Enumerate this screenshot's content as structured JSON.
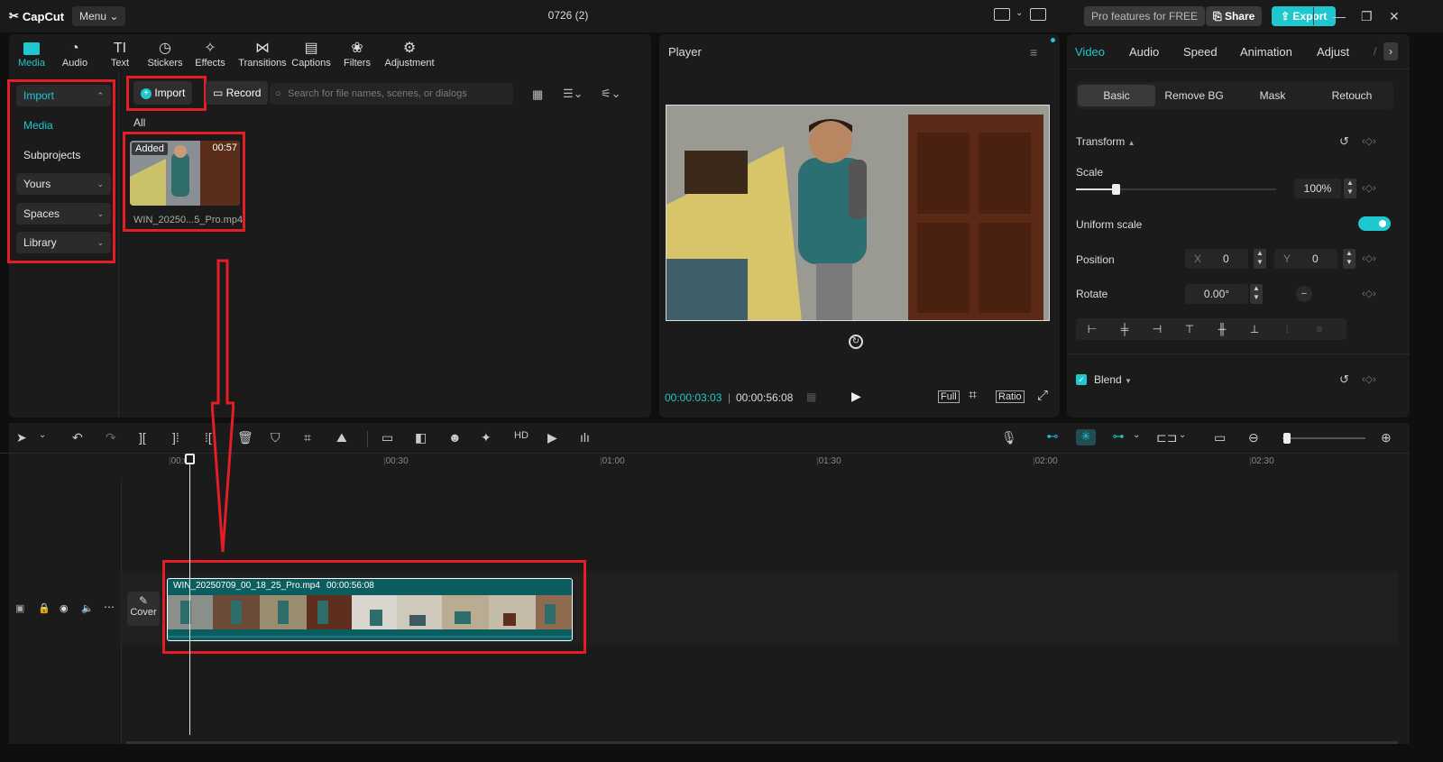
{
  "titlebar": {
    "logo": "CapCut",
    "menu": "Menu",
    "project_title": "0726 (2)",
    "pro_features": "Pro features for FREE",
    "share": "Share",
    "export": "Export"
  },
  "toolbar": {
    "tools": [
      {
        "label": "Media",
        "icon": "media-icon"
      },
      {
        "label": "Audio",
        "icon": "audio-icon"
      },
      {
        "label": "Text",
        "icon": "text-icon"
      },
      {
        "label": "Stickers",
        "icon": "stickers-icon"
      },
      {
        "label": "Effects",
        "icon": "effects-icon"
      },
      {
        "label": "Transitions",
        "icon": "transitions-icon"
      },
      {
        "label": "Captions",
        "icon": "captions-icon"
      },
      {
        "label": "Filters",
        "icon": "filters-icon"
      },
      {
        "label": "Adjustment",
        "icon": "adjustment-icon"
      }
    ]
  },
  "sidebar": {
    "items": [
      {
        "label": "Import"
      },
      {
        "label": "Media"
      },
      {
        "label": "Subprojects"
      },
      {
        "label": "Yours"
      },
      {
        "label": "Spaces"
      },
      {
        "label": "Library"
      }
    ]
  },
  "media": {
    "import_button": "Import",
    "record_button": "Record",
    "search_placeholder": "Search for file names, scenes, or dialogs",
    "filter_all": "All",
    "item": {
      "badge": "Added",
      "duration": "00:57",
      "filename": "WIN_20250...5_Pro.mp4"
    }
  },
  "player": {
    "title": "Player",
    "current_time": "00:00:03:03",
    "total_time": "00:00:56:08",
    "full_label": "Full",
    "ratio_label": "Ratio"
  },
  "properties": {
    "tabs": [
      "Video",
      "Audio",
      "Speed",
      "Animation",
      "Adjust"
    ],
    "subtabs": [
      "Basic",
      "Remove BG",
      "Mask",
      "Retouch"
    ],
    "transform_label": "Transform",
    "scale_label": "Scale",
    "scale_value": "100%",
    "scale_fraction": 0.2,
    "uniform_scale_label": "Uniform scale",
    "uniform_scale_on": true,
    "position_label": "Position",
    "pos_x_label": "X",
    "pos_x": "0",
    "pos_y_label": "Y",
    "pos_y": "0",
    "rotate_label": "Rotate",
    "rotate_value": "0.00°",
    "blend_label": "Blend"
  },
  "timeline": {
    "ruler": [
      "00:00",
      "00:30",
      "01:00",
      "01:30",
      "02:00",
      "02:30"
    ],
    "cover_label": "Cover",
    "clip_name": "WIN_20250709_00_18_25_Pro.mp4",
    "clip_duration": "00:00:56:08",
    "zoom_fraction": 0.05
  },
  "colors": {
    "accent": "#1fc7cf",
    "annotation_red": "#e31e24",
    "clip_teal": "#0b5d5f"
  }
}
